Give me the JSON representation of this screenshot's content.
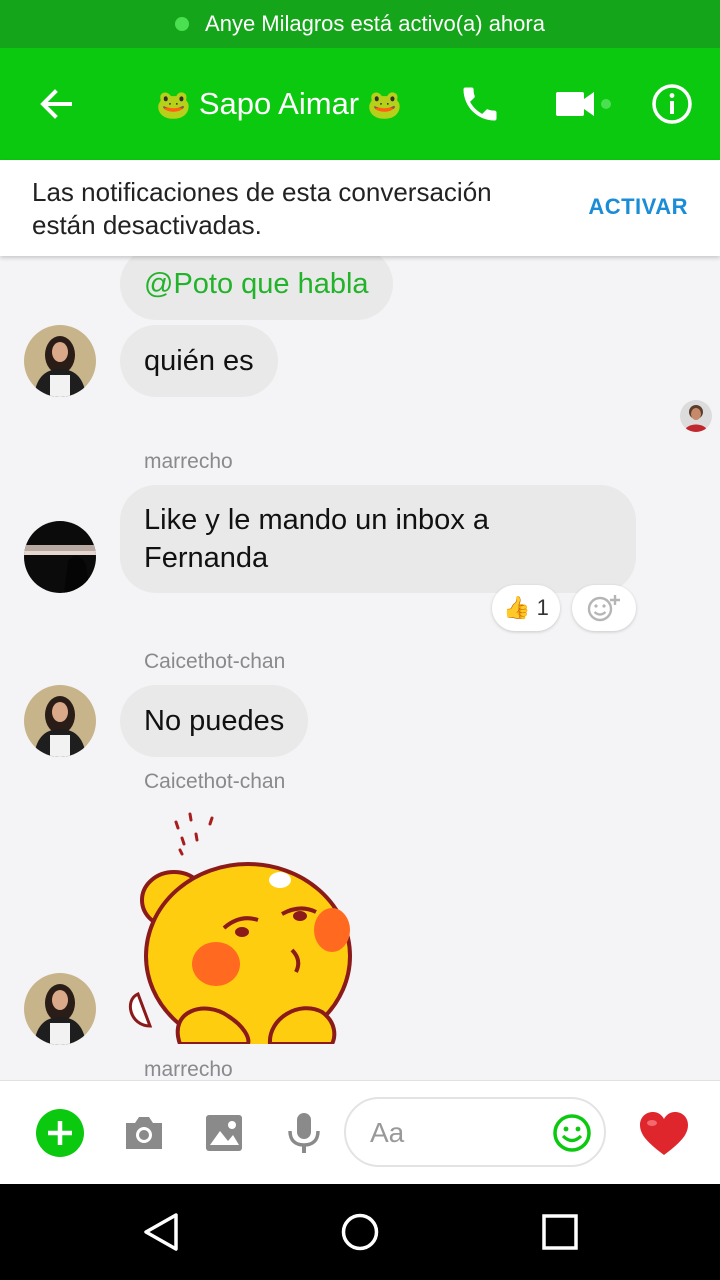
{
  "status": {
    "active_text": "Anye Milagros está activo(a) ahora"
  },
  "header": {
    "title": "Sapo Aimar",
    "title_emoji": "🐸"
  },
  "notification": {
    "text": "Las notificaciones de esta conversación están desactivadas.",
    "action": "ACTIVAR"
  },
  "messages": {
    "m1": {
      "text": "@Poto que habla"
    },
    "m2": {
      "text": "quién es"
    },
    "m3": {
      "sender": "marrecho",
      "text": "Like y le mando un inbox a Fernanda",
      "reaction_emoji": "👍",
      "reaction_count": "1"
    },
    "m4": {
      "sender": "Caicethot-chan",
      "text": "No puedes"
    },
    "m5": {
      "sender": "Caicethot-chan"
    },
    "m6": {
      "sender": "marrecho"
    }
  },
  "composer": {
    "placeholder": "Aa"
  },
  "colors": {
    "header": "#0ac90f",
    "status_bar": "#15a51a",
    "accent": "#1a8cd8",
    "mention": "#22b32a",
    "heart": "#e0262d"
  },
  "icons": [
    "back-arrow-icon",
    "phone-icon",
    "video-camera-icon",
    "info-icon",
    "plus-icon",
    "camera-icon",
    "gallery-icon",
    "microphone-icon",
    "emoji-icon",
    "heart-icon",
    "back-triangle-icon",
    "home-circle-icon",
    "recents-square-icon"
  ]
}
